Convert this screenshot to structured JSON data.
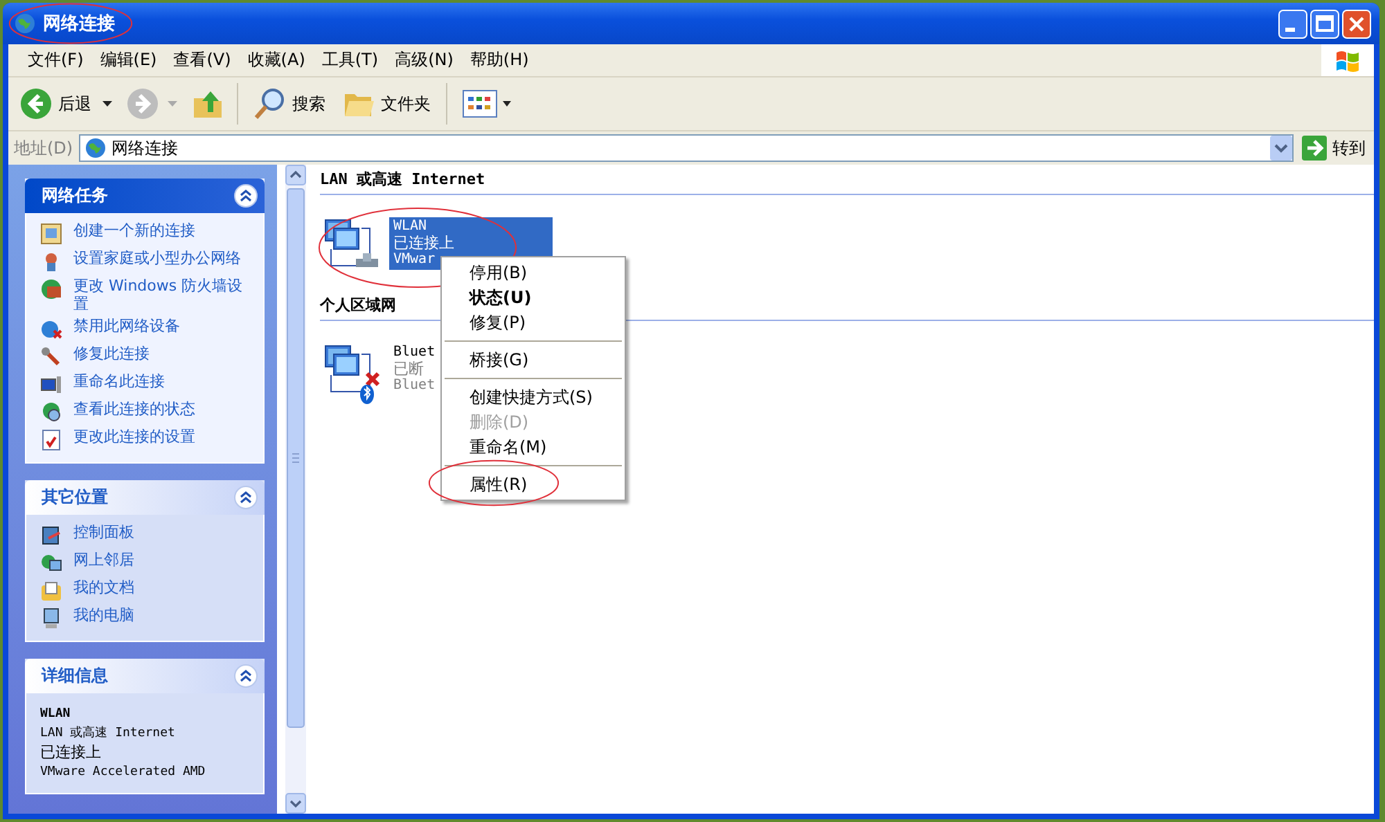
{
  "window": {
    "title": "网络连接",
    "title_circled": true
  },
  "menu_bar": [
    "文件(F)",
    "编辑(E)",
    "查看(V)",
    "收藏(A)",
    "工具(T)",
    "高级(N)",
    "帮助(H)"
  ],
  "toolbar": {
    "back": "后退",
    "search": "搜索",
    "folders": "文件夹"
  },
  "address_bar": {
    "label": "地址(D)",
    "value": "网络连接",
    "go": "转到"
  },
  "sidebar": {
    "panels": [
      {
        "kind": "tasks",
        "title": "网络任务",
        "expanded": true,
        "items": [
          "创建一个新的连接",
          "设置家庭或小型办公网络",
          "更改 Windows 防火墙设置",
          "禁用此网络设备",
          "修复此连接",
          "重命名此连接",
          "查看此连接的状态",
          "更改此连接的设置"
        ]
      },
      {
        "kind": "places",
        "title": "其它位置",
        "expanded": true,
        "items": [
          "控制面板",
          "网上邻居",
          "我的文档",
          "我的电脑"
        ]
      },
      {
        "kind": "details",
        "title": "详细信息",
        "expanded": true,
        "lines": [
          "WLAN",
          "LAN 或高速 Internet",
          "已连接上",
          "VMware Accelerated AMD"
        ]
      }
    ]
  },
  "content": {
    "groups": [
      {
        "title": "LAN 或高速 Internet",
        "connections": [
          {
            "lines": [
              "WLAN",
              "已连接上",
              "VMwar"
            ],
            "selected": true,
            "connected": true,
            "circled": true
          }
        ]
      },
      {
        "title": "个人区域网",
        "connections": [
          {
            "lines": [
              "Bluet",
              "已断",
              "Bluet"
            ],
            "selected": false,
            "connected": false,
            "circled": false
          }
        ]
      }
    ]
  },
  "context_menu": [
    {
      "kind": "item",
      "label": "停用(B)",
      "bold": false,
      "disabled": false,
      "circled": false
    },
    {
      "kind": "item",
      "label": "状态(U)",
      "bold": true,
      "disabled": false,
      "circled": false
    },
    {
      "kind": "item",
      "label": "修复(P)",
      "bold": false,
      "disabled": false,
      "circled": false
    },
    {
      "kind": "separator"
    },
    {
      "kind": "item",
      "label": "桥接(G)",
      "bold": false,
      "disabled": false,
      "circled": false
    },
    {
      "kind": "separator"
    },
    {
      "kind": "item",
      "label": "创建快捷方式(S)",
      "bold": false,
      "disabled": false,
      "circled": false
    },
    {
      "kind": "item",
      "label": "删除(D)",
      "bold": false,
      "disabled": true,
      "circled": false
    },
    {
      "kind": "item",
      "label": "重命名(M)",
      "bold": false,
      "disabled": false,
      "circled": false
    },
    {
      "kind": "separator"
    },
    {
      "kind": "item",
      "label": "属性(R)",
      "bold": false,
      "disabled": false,
      "circled": true
    }
  ]
}
